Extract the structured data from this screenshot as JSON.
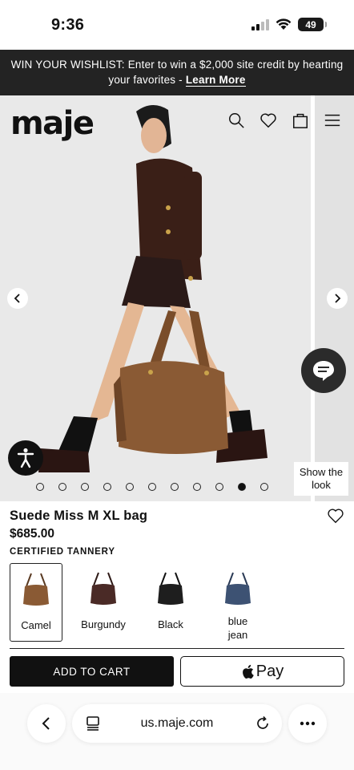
{
  "status_bar": {
    "time": "9:36",
    "battery": "49"
  },
  "promo": {
    "text": "WIN YOUR WISHLIST: Enter to win a $2,000 site credit by hearting your favorites - ",
    "link": "Learn More"
  },
  "header": {
    "logo": "maje",
    "icons": [
      "search-icon",
      "heart-icon",
      "bag-icon",
      "menu-icon"
    ]
  },
  "gallery": {
    "dot_count": 11,
    "active_index": 9,
    "show_the_look": "Show the look"
  },
  "product": {
    "name": "Suede Miss M XL bag",
    "price": "$685.00",
    "badge": "CERTIFIED TANNERY",
    "colors": [
      {
        "label": "Camel",
        "hex": "#8a5a34",
        "selected": true
      },
      {
        "label": "Burgundy",
        "hex": "#4a2a26",
        "selected": false
      },
      {
        "label": "Black",
        "hex": "#1e1e1e",
        "selected": false
      },
      {
        "label": "blue jean",
        "hex": "#3d5273",
        "selected": false
      }
    ]
  },
  "actions": {
    "add_to_cart": "ADD TO CART",
    "apple_pay": "Pay"
  },
  "browser": {
    "url": "us.maje.com"
  },
  "colors": {
    "banner_bg": "#232323",
    "cart_button": "#111111",
    "hero_bg": "#e8e8e8"
  }
}
